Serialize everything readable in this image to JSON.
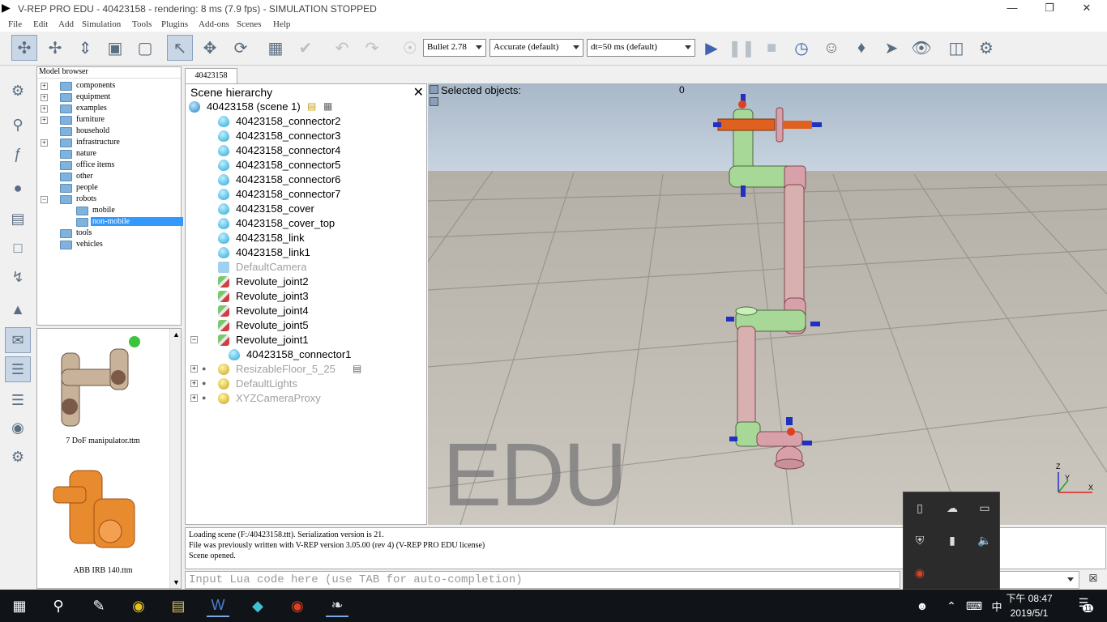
{
  "window": {
    "title": "V-REP PRO EDU - 40423158 - rendering: 8 ms (7.9 fps) - SIMULATION STOPPED",
    "controls": [
      "—",
      "❐",
      "✕"
    ]
  },
  "menu": [
    "File",
    "Edit",
    "Add",
    "Simulation",
    "Tools",
    "Plugins",
    "Add-ons",
    "Scenes",
    "Help"
  ],
  "toolbar": {
    "engine": "Bullet 2.78",
    "accuracy": "Accurate (default)",
    "timestep": "dt=50 ms (default)"
  },
  "model_browser": {
    "header": "Model browser",
    "folders": [
      {
        "label": "components",
        "expand": "+"
      },
      {
        "label": "equipment",
        "expand": "+"
      },
      {
        "label": "examples",
        "expand": "+"
      },
      {
        "label": "furniture",
        "expand": "+"
      },
      {
        "label": "household",
        "expand": ""
      },
      {
        "label": "infrastructure",
        "expand": "+"
      },
      {
        "label": "nature",
        "expand": ""
      },
      {
        "label": "office items",
        "expand": ""
      },
      {
        "label": "other",
        "expand": ""
      },
      {
        "label": "people",
        "expand": ""
      },
      {
        "label": "robots",
        "expand": "−"
      },
      {
        "label": "mobile",
        "expand": ""
      },
      {
        "label": "non-mobile",
        "expand": ""
      },
      {
        "label": "tools",
        "expand": ""
      },
      {
        "label": "vehicles",
        "expand": ""
      }
    ],
    "thumbnails": [
      "7 DoF manipulator.ttm",
      "ABB IRB 140.ttm"
    ]
  },
  "scene_tab": "40423158",
  "hierarchy": {
    "title": "Scene hierarchy",
    "close": "✕",
    "root": "40423158 (scene 1)",
    "items": [
      {
        "label": "40423158_connector2",
        "type": "shape"
      },
      {
        "label": "40423158_connector3",
        "type": "shape"
      },
      {
        "label": "40423158_connector4",
        "type": "shape"
      },
      {
        "label": "40423158_connector5",
        "type": "shape"
      },
      {
        "label": "40423158_connector6",
        "type": "shape"
      },
      {
        "label": "40423158_connector7",
        "type": "shape"
      },
      {
        "label": "40423158_cover",
        "type": "shape"
      },
      {
        "label": "40423158_cover_top",
        "type": "shape"
      },
      {
        "label": "40423158_link",
        "type": "shape"
      },
      {
        "label": "40423158_link1",
        "type": "shape"
      },
      {
        "label": "DefaultCamera",
        "type": "cam"
      },
      {
        "label": "Revolute_joint2",
        "type": "joint"
      },
      {
        "label": "Revolute_joint3",
        "type": "joint"
      },
      {
        "label": "Revolute_joint4",
        "type": "joint"
      },
      {
        "label": "Revolute_joint5",
        "type": "joint"
      },
      {
        "label": "Revolute_joint1",
        "type": "joint"
      },
      {
        "label": "40423158_connector1",
        "type": "shape"
      },
      {
        "label": "ResizableFloor_5_25",
        "type": "dummy"
      },
      {
        "label": "DefaultLights",
        "type": "dummy"
      },
      {
        "label": "XYZCameraProxy",
        "type": "dummy"
      }
    ]
  },
  "viewport": {
    "selected_label": "Selected objects:",
    "selected_count": "0",
    "watermark": "EDU",
    "axes": [
      "X",
      "Y",
      "Z"
    ]
  },
  "console": {
    "lines": [
      "Loading scene (F:/40423158.ttt).  Serialization version is 21.",
      "File was previously written with V-REP version 3.05.00 (rev 4) (V-REP PRO EDU license)",
      "Scene opened."
    ]
  },
  "lua": {
    "placeholder": "Input Lua code here (use TAB for auto-completion)"
  },
  "taskbar": {
    "time": "下午 08:47",
    "date": "2019/5/1",
    "ime": "中",
    "notif_count": "11"
  }
}
